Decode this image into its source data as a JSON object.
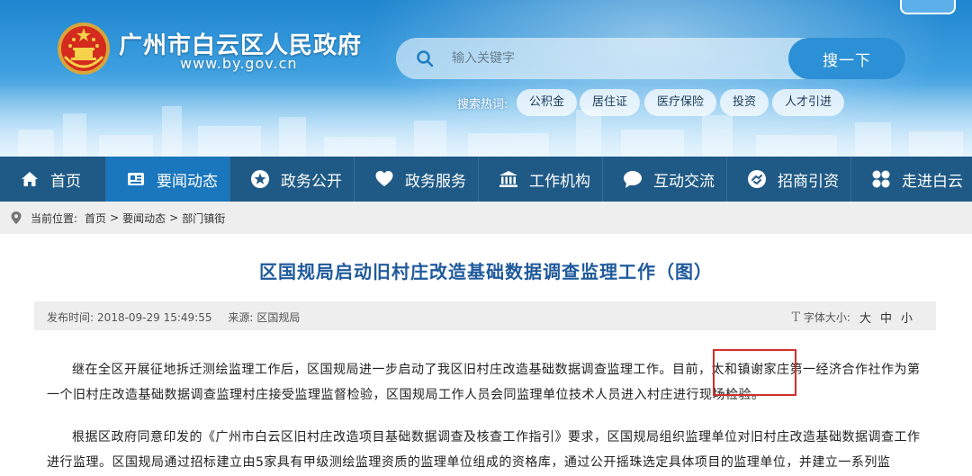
{
  "site": {
    "name": "广州市白云区人民政府",
    "url": "www.by.gov.cn"
  },
  "search": {
    "placeholder": "输入关键字",
    "button_label": "搜一下",
    "hot_label": "搜索热词:",
    "hot_tags": [
      "公积金",
      "居住证",
      "医疗保险",
      "投资",
      "人才引进"
    ]
  },
  "nav": {
    "items": [
      {
        "label": "首页",
        "icon": "home-icon"
      },
      {
        "label": "要闻动态",
        "icon": "news-icon",
        "active": true
      },
      {
        "label": "政务公开",
        "icon": "star-badge-icon"
      },
      {
        "label": "政务服务",
        "icon": "heart-icon"
      },
      {
        "label": "工作机构",
        "icon": "building-icon"
      },
      {
        "label": "互动交流",
        "icon": "chat-bubble-icon"
      },
      {
        "label": "招商引资",
        "icon": "handshake-icon"
      },
      {
        "label": "走进白云",
        "icon": "grid-clover-icon"
      }
    ]
  },
  "breadcrumb": {
    "label": "当前位置:",
    "items": [
      "首页",
      "要闻动态",
      "部门镇街"
    ],
    "separator": ">"
  },
  "article": {
    "title": "区国规局启动旧村庄改造基础数据调查监理工作（图）",
    "meta": {
      "publish_time_label": "发布时间:",
      "publish_time": "2018-09-29 15:49:55",
      "source_label": "来源:",
      "source": "区国规局",
      "font_size_label": "字体大小:",
      "font_size_options": [
        "大",
        "中",
        "小"
      ]
    },
    "paragraphs": [
      {
        "before": "继在全区开展征地拆迁测绘监理工作后，区国规局进一步启动了我区旧村庄改造基础数据调查监理工作。目前，",
        "highlight": "太和镇谢家庄",
        "after": "第一经济合作社作为第一个旧村庄改造基础数据调查监理村庄接受监理监督检验，区国规局工作人员会同监理单位技术人员进入村庄进行现场检验。"
      },
      {
        "text": "根据区政府同意印发的《广州市白云区旧村庄改造项目基础数据调查及核查工作指引》要求，区国规局组织监理单位对旧村庄改造基础数据调查工作进行监理。区国规局通过招标建立由5家具有甲级测绘监理资质的监理单位组成的资格库，通过公开摇珠选定具体项目的监理单位，并建立一系列监"
      }
    ]
  },
  "colors": {
    "nav_bg": "#1f5a86",
    "nav_active": "#1a76bd",
    "title_blue": "#1f5a9c",
    "highlight_red": "#d0312d"
  }
}
